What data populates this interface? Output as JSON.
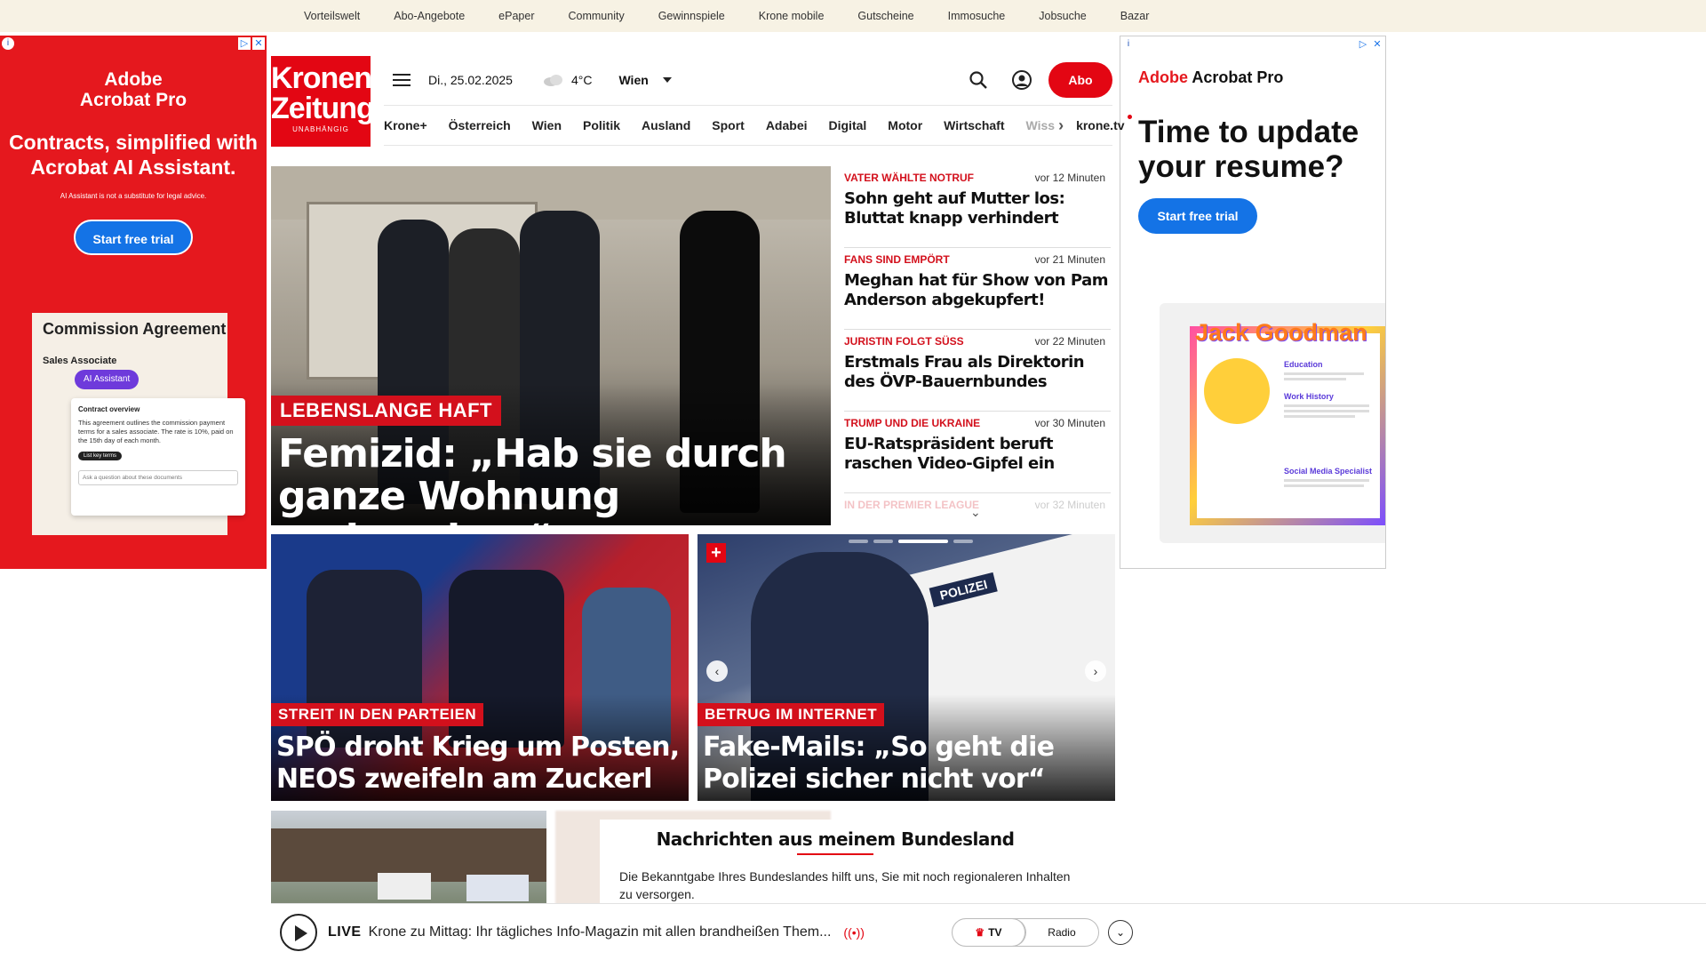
{
  "topbar": {
    "links": [
      "Vorteilswelt",
      "Abo-Angebote",
      "ePaper",
      "Community",
      "Gewinnspiele",
      "Krone mobile",
      "Gutscheine",
      "Immosuche",
      "Jobsuche",
      "Bazar"
    ]
  },
  "ad_left": {
    "brand": "Adobe\nAcrobat Pro",
    "headline": "Contracts, simplified with Acrobat AI Assistant.",
    "disclaimer": "AI Assistant is not a substitute for legal advice.",
    "cta": "Start free trial",
    "doc_title": "Commission Agreement",
    "doc_subtitle": "Sales Associate",
    "pill": "AI Assistant",
    "popup_title": "Contract overview",
    "popup_text": "This agreement outlines the commission payment terms for a sales associate. The rate is 10%, paid on the 15th day of each month.",
    "popup_button": "List key terms",
    "popup_ask": "Ask a question about these documents"
  },
  "ad_right": {
    "brand_red": "Adobe",
    "brand_rest": " Acrobat Pro",
    "headline": "Time to update your resume?",
    "cta": "Start free trial",
    "resume_name": "Jack Goodman",
    "resume_sections": [
      "Education",
      "Work History",
      "Social Media Specialist"
    ]
  },
  "header": {
    "logo_line1": "Kronen",
    "logo_line2": "Zeitung",
    "logo_tag": "UNABHÄNGIG",
    "date": "Di., 25.02.2025",
    "temperature": "4°C",
    "city": "Wien",
    "abo": "Abo"
  },
  "nav": {
    "items": [
      "Krone+",
      "Österreich",
      "Wien",
      "Politik",
      "Ausland",
      "Sport",
      "Adabei",
      "Digital",
      "Motor",
      "Wirtschaft"
    ],
    "faded": "Wiss",
    "last": "krone.tv"
  },
  "hero": {
    "kicker": "LEBENSLANGE HAFT",
    "title": "Femizid: „Hab sie durch ganze Wohnung gedroschen“"
  },
  "news": [
    {
      "kicker": "VATER WÄHLTE NOTRUF",
      "time": "vor 12 Minuten",
      "title": "Sohn geht auf Mutter los: Bluttat knapp verhindert"
    },
    {
      "kicker": "FANS SIND EMPÖRT",
      "time": "vor 21 Minuten",
      "title": "Meghan hat für Show von Pam Anderson abgekupfert!"
    },
    {
      "kicker": "JURISTIN FOLGT SÜSS",
      "time": "vor 22 Minuten",
      "title": "Erstmals Frau als Direktorin des ÖVP-Bauernbundes"
    },
    {
      "kicker": "TRUMP UND DIE UKRAINE",
      "time": "vor 30 Minuten",
      "title": "EU-Ratspräsident beruft raschen Video-Gipfel ein"
    },
    {
      "kicker": "IN DER PREMIER LEAGUE",
      "time": "vor 32 Minuten",
      "title": ""
    }
  ],
  "cards": [
    {
      "kicker": "STREIT IN DEN PARTEIEN",
      "title": "SPÖ droht Krieg um Posten, NEOS zweifeln am Zuckerl"
    },
    {
      "kicker": "BETRUG IM INTERNET",
      "title": "Fake-Mails: „So geht die Polizei sicher nicht vor“",
      "plus": "+",
      "paper_label": "POLIZEI"
    }
  ],
  "region": {
    "title": "Nachrichten aus meinem Bundesland",
    "text": "Die Bekanntgabe Ihres Bundeslandes hilft uns, Sie mit noch regionaleren Inhalten zu versorgen."
  },
  "livebar": {
    "live": "LIVE",
    "text": "Krone zu Mittag: Ihr tägliches Info-Magazin mit allen brandheißen Them...",
    "tv": "TV",
    "radio": "Radio"
  }
}
